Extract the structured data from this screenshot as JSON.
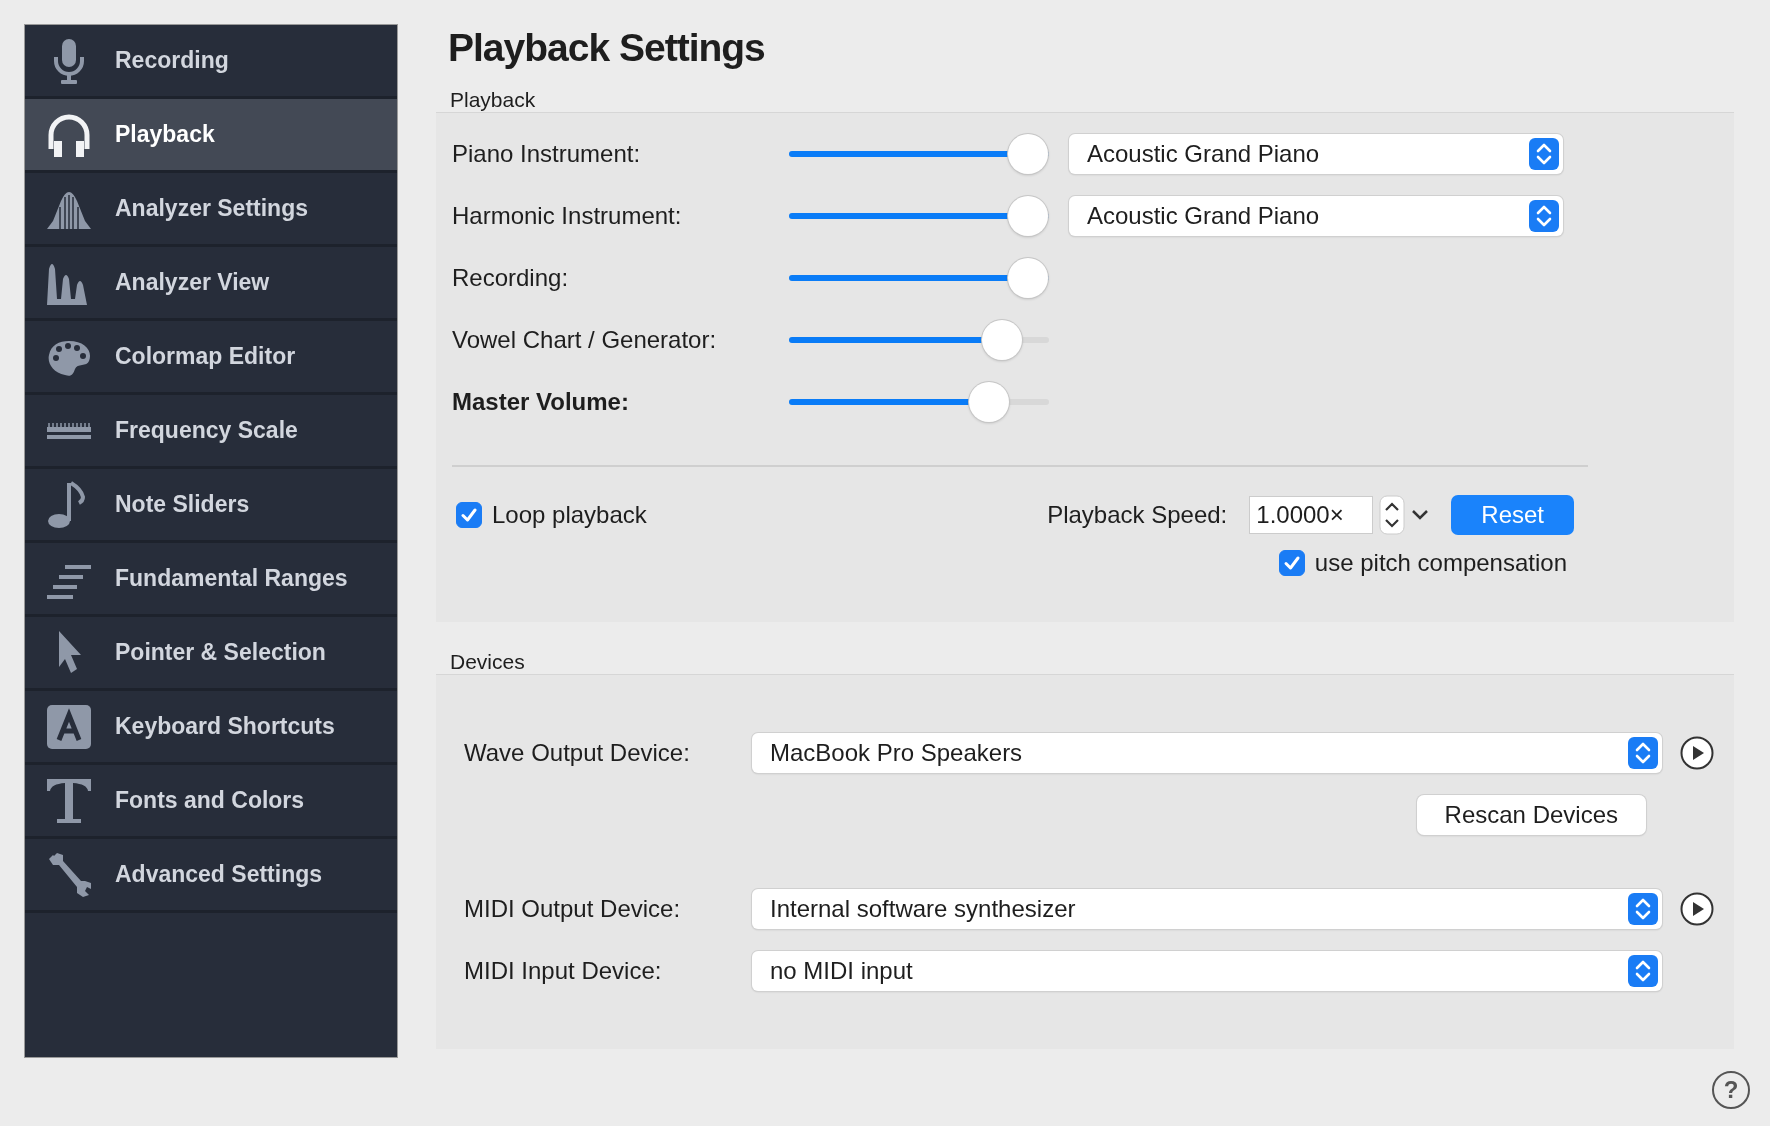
{
  "sidebar": {
    "items": [
      {
        "label": "Recording",
        "selected": false
      },
      {
        "label": "Playback",
        "selected": true
      },
      {
        "label": "Analyzer Settings",
        "selected": false
      },
      {
        "label": "Analyzer View",
        "selected": false
      },
      {
        "label": "Colormap Editor",
        "selected": false
      },
      {
        "label": "Frequency Scale",
        "selected": false
      },
      {
        "label": "Note Sliders",
        "selected": false
      },
      {
        "label": "Fundamental Ranges",
        "selected": false
      },
      {
        "label": "Pointer & Selection",
        "selected": false
      },
      {
        "label": "Keyboard Shortcuts",
        "selected": false
      },
      {
        "label": "Fonts and Colors",
        "selected": false
      },
      {
        "label": "Advanced Settings",
        "selected": false
      }
    ]
  },
  "title": "Playback Settings",
  "playback": {
    "heading": "Playback",
    "sliders": [
      {
        "label": "Piano Instrument:",
        "level": 1.0,
        "emphasized": false,
        "instrument": "Acoustic Grand Piano"
      },
      {
        "label": "Harmonic Instrument:",
        "level": 1.0,
        "emphasized": false,
        "instrument": "Acoustic Grand Piano"
      },
      {
        "label": "Recording:",
        "level": 1.0,
        "emphasized": false
      },
      {
        "label": "Vowel Chart / Generator:",
        "level": 0.88,
        "emphasized": false
      },
      {
        "label": "Master Volume:",
        "level": 0.82,
        "emphasized": true
      }
    ],
    "loop": {
      "label": "Loop playback",
      "checked": true
    },
    "speed_label": "Playback Speed:",
    "speed_value": "1.0000×",
    "reset_button": "Reset",
    "pitch": {
      "label": "use pitch compensation",
      "checked": true
    }
  },
  "devices": {
    "heading": "Devices",
    "wave_output": {
      "label": "Wave Output Device:",
      "value": "MacBook Pro Speakers"
    },
    "rescan_button": "Rescan Devices",
    "midi_output": {
      "label": "MIDI Output Device:",
      "value": "Internal software synthesizer"
    },
    "midi_input": {
      "label": "MIDI Input Device:",
      "value": "no MIDI input"
    }
  },
  "help_button": "?"
}
